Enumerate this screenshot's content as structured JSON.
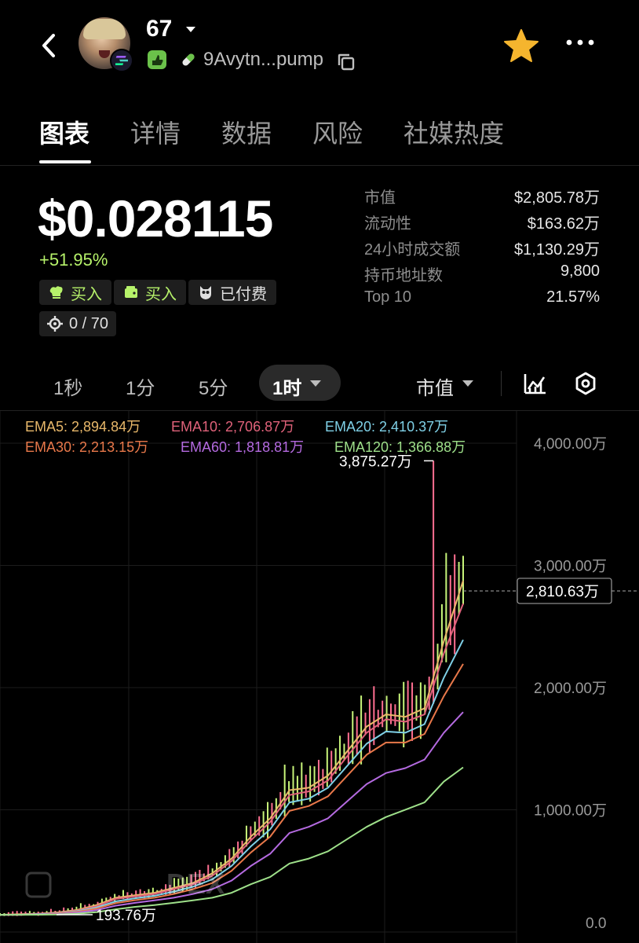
{
  "header": {
    "token_name": "67",
    "address": "9Avytn...pump",
    "icons": [
      "back-icon",
      "solana-icon",
      "pump-icon",
      "pill-icon",
      "copy-icon",
      "star-icon",
      "more-icon",
      "caret-down-icon"
    ]
  },
  "tabs": [
    {
      "label": "图表",
      "active": true
    },
    {
      "label": "详情",
      "active": false
    },
    {
      "label": "数据",
      "active": false
    },
    {
      "label": "风险",
      "active": false
    },
    {
      "label": "社媒热度",
      "active": false
    }
  ],
  "price": {
    "value": "$0.028115",
    "change": "+51.95%"
  },
  "pills": {
    "buy1": "买入",
    "buy2": "买入",
    "paid": "已付费",
    "rank": "0 / 70"
  },
  "stats": [
    {
      "label": "市值",
      "value": "$2,805.78万"
    },
    {
      "label": "流动性",
      "value": "$163.62万"
    },
    {
      "label": "24小时成交额",
      "value": "$1,130.29万"
    },
    {
      "label": "持币地址数",
      "value": "9,800"
    },
    {
      "label": "Top 10",
      "value": "21.57%"
    }
  ],
  "timeframes": {
    "items": [
      "1秒",
      "1分",
      "5分"
    ],
    "selected": "1时",
    "metric": "市值"
  },
  "colors": {
    "accent_green": "#b6f26a",
    "ema5": "#e8b86a",
    "ema10": "#e0627a",
    "ema20": "#7fd0e6",
    "ema30": "#e8784a",
    "ema60": "#b46ae0",
    "ema120": "#9ee08a",
    "star": "#f5b52e"
  },
  "chart": {
    "ema_labels": [
      {
        "name": "EMA5",
        "value": "2,894.84万"
      },
      {
        "name": "EMA10",
        "value": "2,706.87万"
      },
      {
        "name": "EMA20",
        "value": "2,410.37万"
      },
      {
        "name": "EMA30",
        "value": "2,213.15万"
      },
      {
        "name": "EMA60",
        "value": "1,818.81万"
      },
      {
        "name": "EMA120",
        "value": "1,366.88万"
      }
    ],
    "y_ticks": [
      "4,000.00万",
      "3,000.00万",
      "2,000.00万",
      "1,000.00万",
      "0.0"
    ],
    "high_label": "3,875.27万",
    "low_label": "193.76万",
    "current_label": "2,810.63万",
    "watermark": "DEX"
  },
  "chart_data": {
    "type": "line",
    "title": "",
    "xlabel": "",
    "ylabel": "",
    "ylim": [
      0,
      4000
    ],
    "y_ticks": [
      0,
      1000,
      2000,
      3000,
      4000
    ],
    "series": [
      {
        "name": "EMA5",
        "values": [
          160,
          165,
          170,
          180,
          200,
          240,
          300,
          320,
          340,
          380,
          420,
          500,
          620,
          800,
          950,
          1180,
          1200,
          1300,
          1500,
          1700,
          1800,
          1780,
          1850,
          2400,
          2894.84
        ]
      },
      {
        "name": "EMA10",
        "values": [
          160,
          162,
          168,
          175,
          195,
          230,
          290,
          310,
          330,
          370,
          410,
          480,
          600,
          770,
          920,
          1140,
          1170,
          1260,
          1460,
          1650,
          1760,
          1740,
          1800,
          2300,
          2706.87
        ]
      },
      {
        "name": "EMA20",
        "values": [
          160,
          161,
          165,
          172,
          190,
          220,
          270,
          295,
          315,
          350,
          390,
          450,
          560,
          720,
          860,
          1080,
          1110,
          1200,
          1380,
          1560,
          1660,
          1650,
          1720,
          2100,
          2410.37
        ]
      },
      {
        "name": "EMA30",
        "values": [
          160,
          160,
          163,
          170,
          185,
          210,
          255,
          280,
          300,
          330,
          370,
          420,
          520,
          670,
          800,
          1010,
          1050,
          1130,
          1300,
          1470,
          1570,
          1570,
          1640,
          1950,
          2213.15
        ]
      },
      {
        "name": "EMA60",
        "values": [
          160,
          160,
          162,
          166,
          178,
          198,
          235,
          258,
          278,
          300,
          330,
          370,
          440,
          560,
          660,
          830,
          880,
          950,
          1090,
          1230,
          1320,
          1360,
          1430,
          1650,
          1818.81
        ]
      },
      {
        "name": "EMA120",
        "values": [
          160,
          160,
          161,
          163,
          170,
          182,
          205,
          225,
          240,
          258,
          278,
          300,
          340,
          410,
          470,
          580,
          620,
          680,
          780,
          880,
          960,
          1020,
          1080,
          1250,
          1366.88
        ]
      }
    ],
    "annotations": {
      "high": 3875.27,
      "low": 193.76,
      "current": 2810.63
    }
  }
}
